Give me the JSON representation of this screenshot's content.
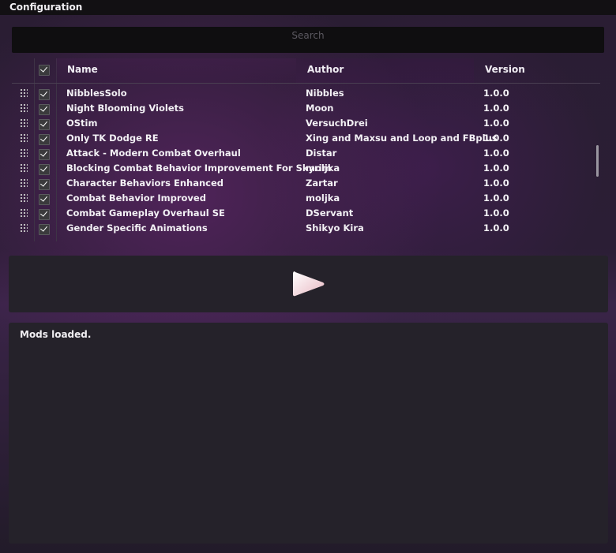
{
  "window": {
    "title": "Configuration"
  },
  "search": {
    "placeholder": "Search",
    "value": ""
  },
  "table": {
    "columns": [
      "Name",
      "Author",
      "Version"
    ],
    "header_checked": true,
    "rows": [
      {
        "name": "NibblesSolo",
        "author": "Nibbles",
        "version": "1.0.0",
        "checked": true
      },
      {
        "name": "Night Blooming Violets",
        "author": "Moon",
        "version": "1.0.0",
        "checked": true
      },
      {
        "name": "OStim",
        "author": "VersuchDrei",
        "version": "1.0.0",
        "checked": true
      },
      {
        "name": "Only TK Dodge RE",
        "author": "Xing and Maxsu and Loop and FBplus",
        "version": "1.0.0",
        "checked": true
      },
      {
        "name": "Attack - Modern Combat Overhaul",
        "author": "Distar",
        "version": "1.0.0",
        "checked": true
      },
      {
        "name": "Blocking Combat Behavior Improvement For Skyrim",
        "author": "moljka",
        "version": "1.0.0",
        "checked": true
      },
      {
        "name": "Character Behaviors Enhanced",
        "author": "Zartar",
        "version": "1.0.0",
        "checked": true
      },
      {
        "name": "Combat Behavior Improved",
        "author": "moljka",
        "version": "1.0.0",
        "checked": true
      },
      {
        "name": "Combat Gameplay Overhaul SE",
        "author": "DServant",
        "version": "1.0.0",
        "checked": true
      },
      {
        "name": "Gender Specific Animations",
        "author": "Shikyo Kira",
        "version": "1.0.0",
        "checked": true
      }
    ]
  },
  "play": {
    "icon": "play-icon",
    "color": "#f6d6dc"
  },
  "log": {
    "message": "Mods loaded."
  }
}
